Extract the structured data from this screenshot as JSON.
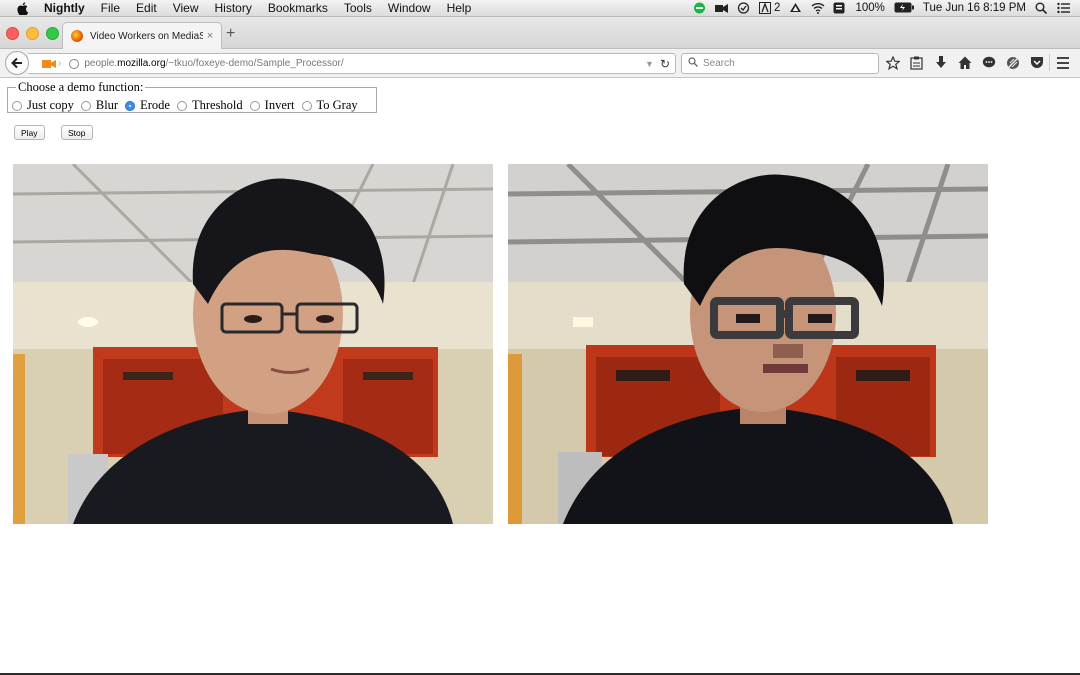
{
  "menubar": {
    "app_name": "Nightly",
    "items": [
      "File",
      "Edit",
      "View",
      "History",
      "Bookmarks",
      "Tools",
      "Window",
      "Help"
    ],
    "tray": {
      "notification_count": "2",
      "battery": "100%",
      "datetime": "Tue Jun 16  8:19 PM"
    }
  },
  "tab": {
    "title": "Video Workers on MediaStr...",
    "close": "×",
    "new_tab": "+"
  },
  "navbar": {
    "url_prefix": "people.",
    "url_domain": "mozilla.org",
    "url_path": "/~tkuo/foxeye-demo/Sample_Processor/",
    "search_placeholder": "Search"
  },
  "page": {
    "legend": "Choose a demo function:",
    "options": [
      {
        "label": "Just copy",
        "selected": false
      },
      {
        "label": "Blur",
        "selected": false
      },
      {
        "label": "Erode",
        "selected": true
      },
      {
        "label": "Threshold",
        "selected": false
      },
      {
        "label": "Invert",
        "selected": false
      },
      {
        "label": "To Gray",
        "selected": false
      }
    ],
    "play_label": "Play",
    "stop_label": "Stop"
  },
  "colors": {
    "selected_radio": "#3b8ff0",
    "close_dot": "#fc605c",
    "minimize_dot": "#fdbc40",
    "zoom_dot": "#34c84a"
  }
}
